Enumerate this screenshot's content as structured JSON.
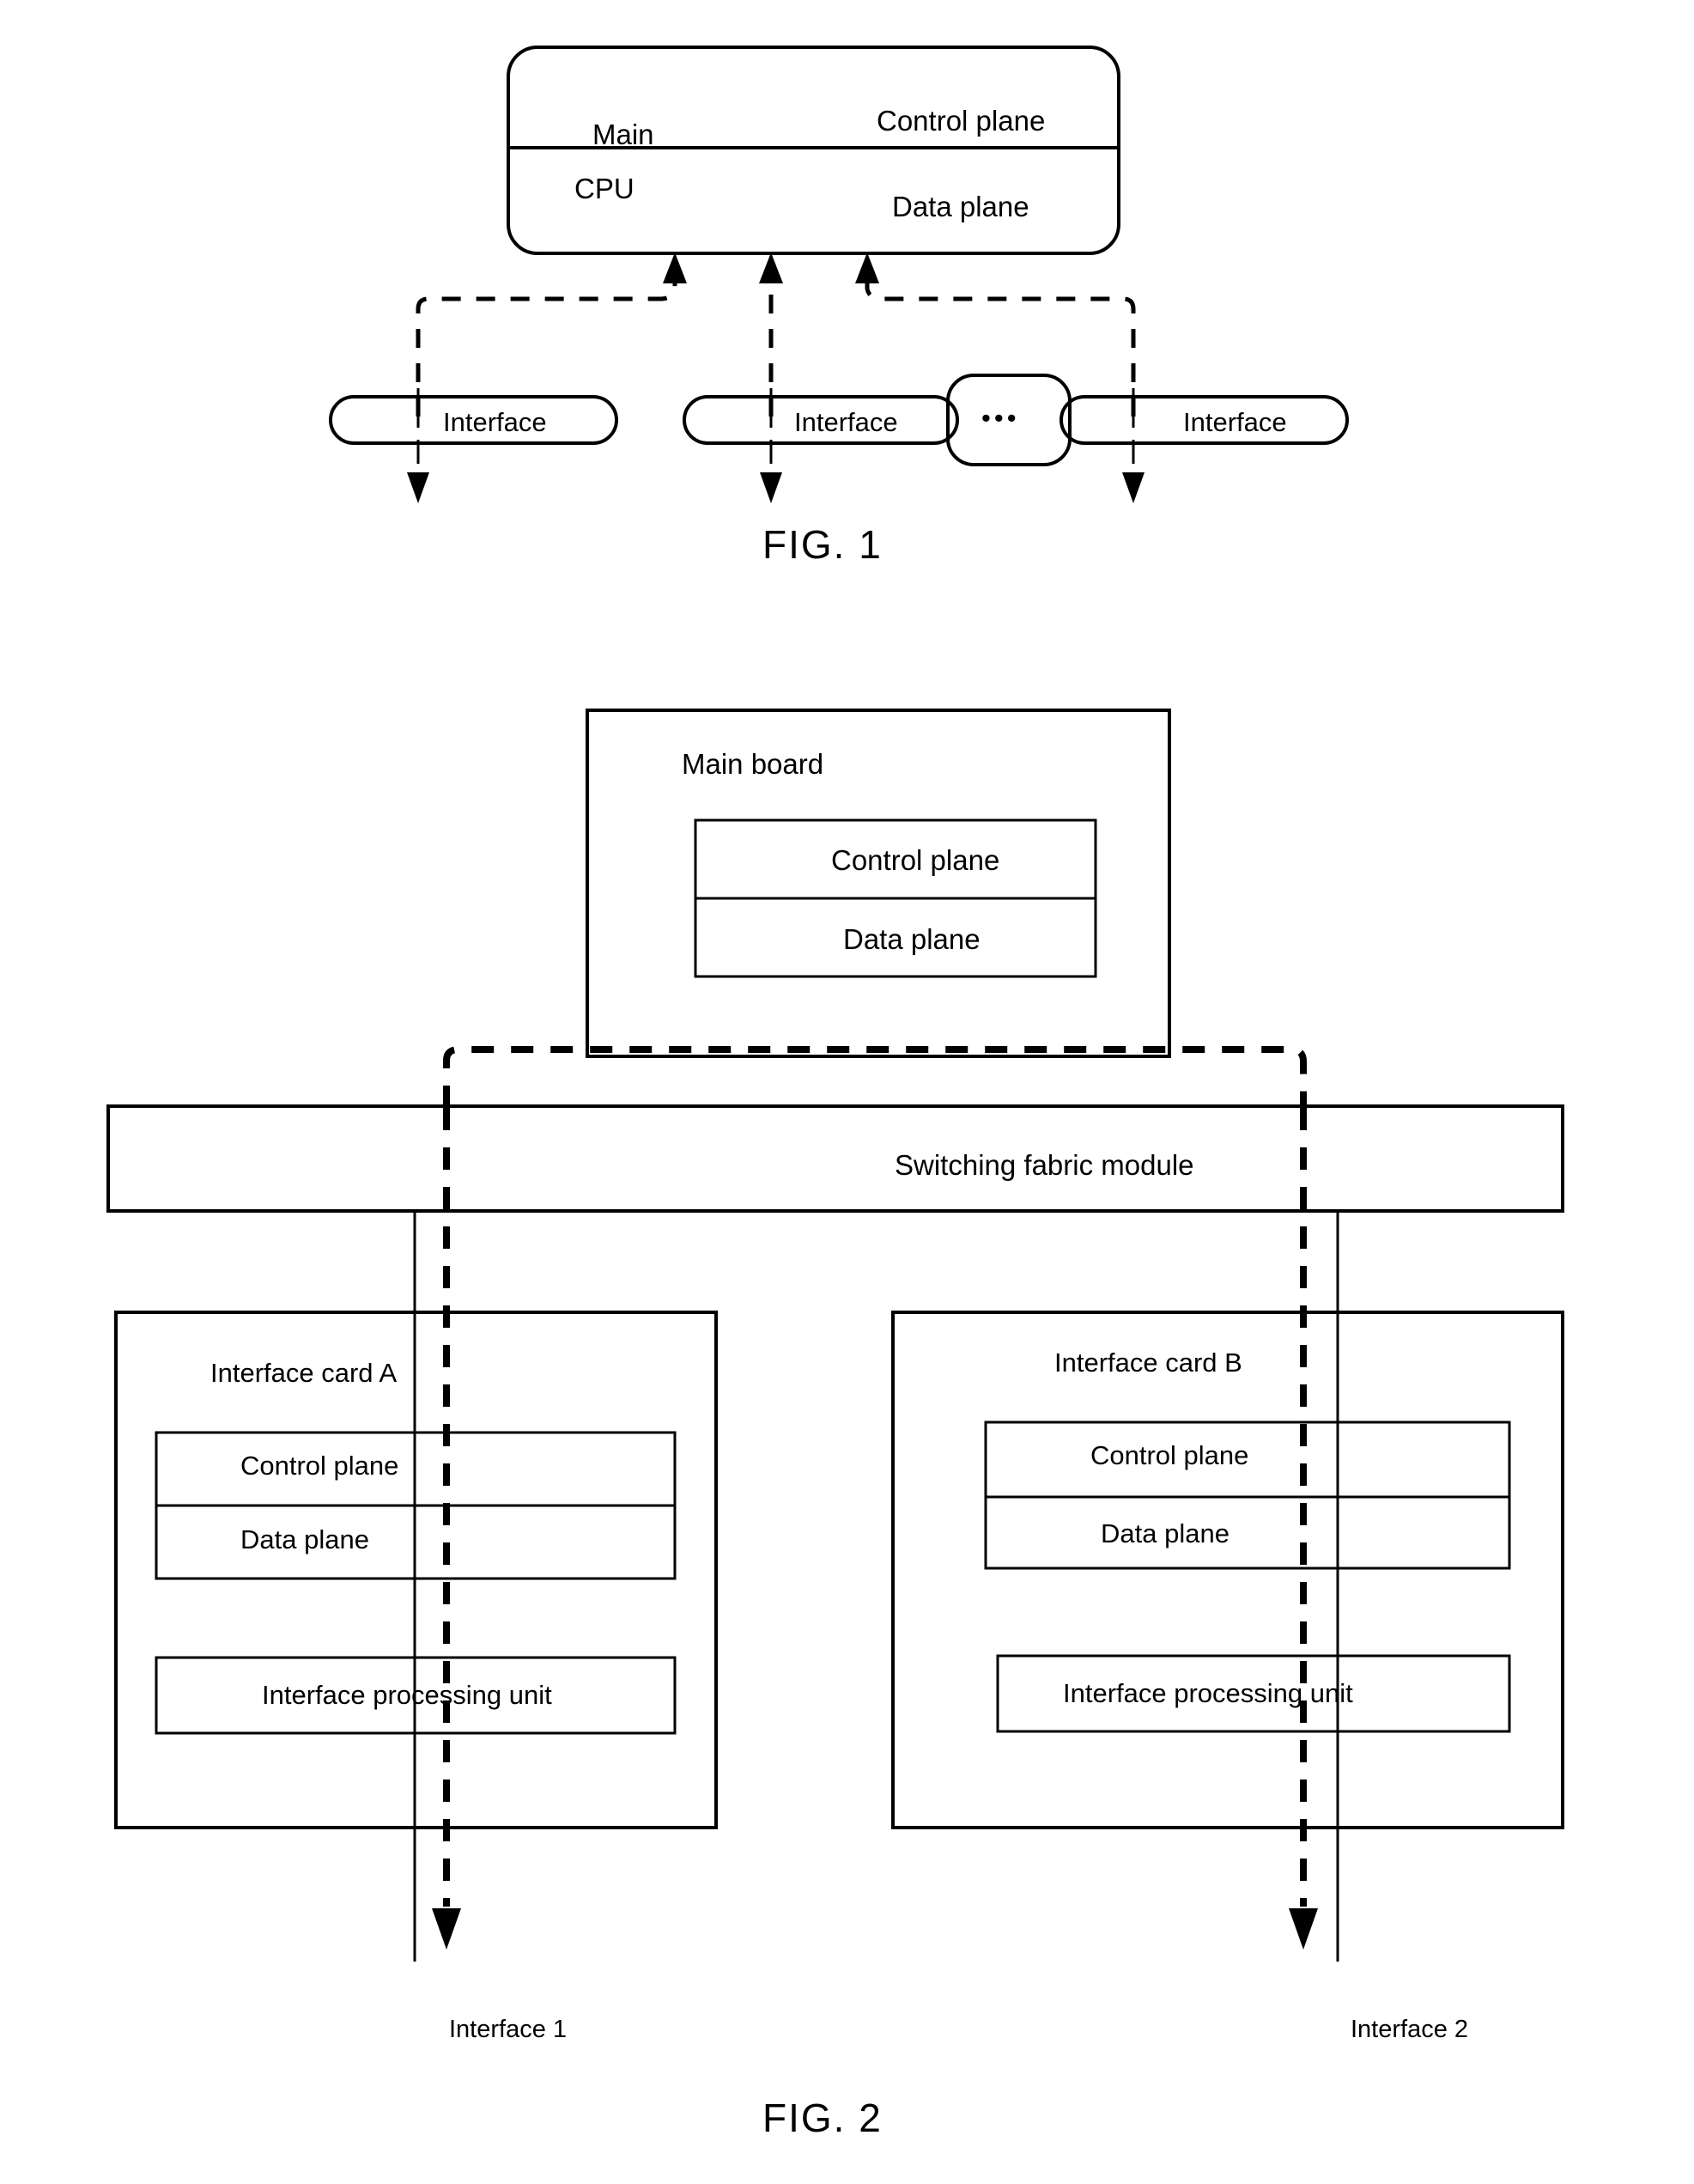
{
  "figures": [
    {
      "id": "fig1",
      "caption": "FIG. 1",
      "main_unit": {
        "label_line1": "Main",
        "label_line2": "CPU",
        "control_plane": "Control plane",
        "data_plane": "Data plane"
      },
      "interfaces": [
        {
          "label": "Interface"
        },
        {
          "label": "Interface"
        },
        {
          "label": "Interface"
        }
      ],
      "ellipsis": "•••"
    },
    {
      "id": "fig2",
      "caption": "FIG. 2",
      "main_board": {
        "title": "Main board",
        "control_plane": "Control plane",
        "data_plane": "Data plane"
      },
      "switching_fabric": {
        "title": "Switching fabric module"
      },
      "interface_cards": [
        {
          "title": "Interface card A",
          "control_plane": "Control plane",
          "data_plane": "Data plane",
          "processing_unit": "Interface processing unit",
          "port_label": "Interface 1"
        },
        {
          "title": "Interface card B",
          "control_plane": "Control plane",
          "data_plane": "Data plane",
          "processing_unit": "Interface processing unit",
          "port_label": "Interface 2"
        }
      ]
    }
  ],
  "colors": {
    "ink": "#000000",
    "paper": "#ffffff"
  }
}
